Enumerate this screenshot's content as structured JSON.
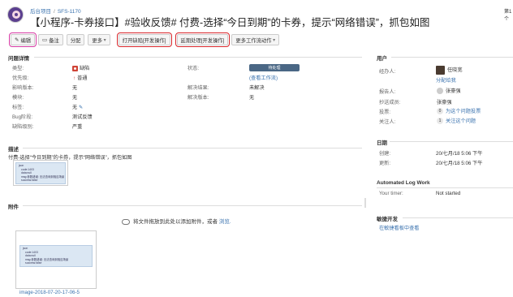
{
  "header": {
    "project": "后台项目",
    "issue_key": "SFS-1170",
    "title": "【小程序-卡券接口】#验收反馈# 付费-选择“今日到期”的卡券，提示“网络错误”，抓包如图",
    "corner_text": "第1个"
  },
  "toolbar": {
    "edit": "编辑",
    "comment": "备注",
    "assign": "分配",
    "more": "更多",
    "start": "打开缺陷[开发操作]",
    "defer": "延期处理[开发操作]",
    "workflow": "更多工作流动作"
  },
  "details": {
    "section": "问题详情",
    "type_label": "类型:",
    "type_value": "缺陷",
    "priority_label": "优先级:",
    "priority_value": "普通",
    "affects_label": "影响版本:",
    "affects_value": "无",
    "module_label": "模块:",
    "module_value": "无",
    "tags_label": "标签:",
    "tags_value": "无",
    "bugstage_label": "Bug阶段:",
    "bugstage_value": "测试反馈",
    "severity_label": "缺陷级别:",
    "severity_value": "严重",
    "status_label": "状态:",
    "status_value": "待处理",
    "workflow_link": "(查看工作流)",
    "resolution_label": "解决结果:",
    "resolution_value": "未解决",
    "fixversion_label": "解决版本:",
    "fixversion_value": "无"
  },
  "description": {
    "section": "描述",
    "text": "付费-选择“今日到期”的卡券，提示“网络错误”，抓包如图",
    "code_lines": [
      "json",
      "code:1403",
      "data:null",
      "msg:参数错误: 无法查询到相应场景",
      "success:false"
    ]
  },
  "attachments": {
    "section": "附件",
    "drop_text": "将文件拖放到此处以添加附件，或者",
    "browse": "浏览.",
    "filename": "image-2018-07-20-17-06-5",
    "code_lines": [
      "json",
      "code:1403",
      "data:null",
      "msg:参数错误: 无法查询到相应场景",
      "success:false"
    ]
  },
  "people": {
    "section": "用户",
    "assignee_label": "经办人:",
    "assignee_value": "任晓宽",
    "assign_me": "分配给我",
    "reporter_label": "报告人:",
    "reporter_value": "张豪强",
    "cc_label": "抄送成员:",
    "cc_value": "张豪强",
    "votes_label": "投票:",
    "votes_count": "0",
    "votes_link": "为这个问题投票",
    "watchers_label": "关注人:",
    "watchers_count": "1",
    "watchers_link": "关注这个问题"
  },
  "dates": {
    "section": "日期",
    "created_label": "创建:",
    "created_value": "20/七月/18 5:06 下午",
    "updated_label": "更新:",
    "updated_value": "20/七月/18 5:06 下午"
  },
  "worklog": {
    "section": "Automated Log Work",
    "timer_label": "Your timer:",
    "timer_value": "Not started"
  },
  "agile": {
    "section": "敏捷开发",
    "link": "在敏捷看板中查看"
  }
}
